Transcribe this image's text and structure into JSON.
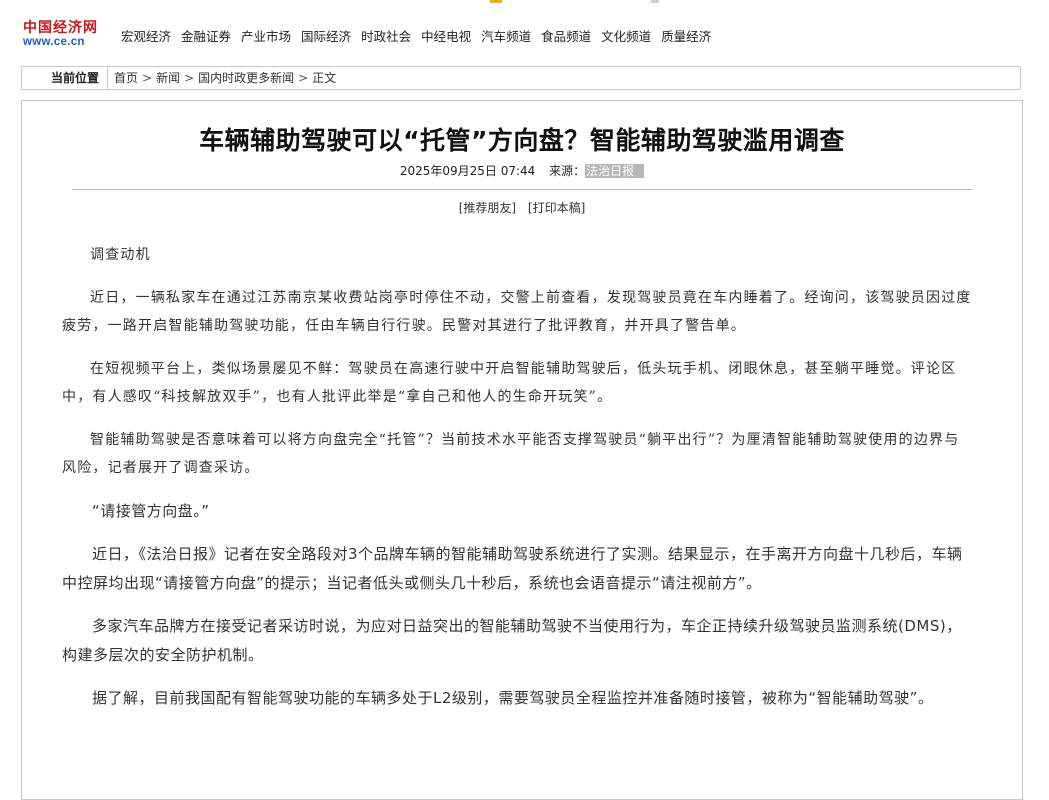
{
  "site": {
    "logo_text": "中国经济网",
    "logo_url": "www.ce.cn"
  },
  "nav": [
    "宏观经济",
    "金融证券",
    "产业市场",
    "国际经济",
    "时政社会",
    "中经电视",
    "汽车频道",
    "食品频道",
    "文化频道",
    "质量经济"
  ],
  "breadcrumb": {
    "label": "当前位置",
    "items": [
      "首页",
      "新闻",
      "国内时政更多新闻",
      "正文"
    ],
    "separator": ">"
  },
  "article": {
    "title": "车辆辅助驾驶可以“托管”方向盘？智能辅助驾驶滥用调查",
    "datetime": "2025年09月25日 07:44",
    "source_label": "来源：",
    "source": "法治日报",
    "tools": [
      "[推荐朋友]",
      "[打印本稿]"
    ],
    "paragraphs": [
      "调查动机",
      "近日，一辆私家车在通过江苏南京某收费站岗亭时停住不动，交警上前查看，发现驾驶员竟在车内睡着了。经询问，该驾驶员因过度疲劳，一路开启智能辅助驾驶功能，任由车辆自行行驶。民警对其进行了批评教育，并开具了警告单。",
      "在短视频平台上，类似场景屡见不鲜：驾驶员在高速行驶中开启智能辅助驾驶后，低头玩手机、闭眼休息，甚至躺平睡觉。评论区中，有人感叹“科技解放双手”，也有人批评此举是“拿自己和他人的生命开玩笑”。",
      "智能辅助驾驶是否意味着可以将方向盘完全“托管”？当前技术水平能否支撑驾驶员“躺平出行”？为厘清智能辅助驾驶使用的边界与风险，记者展开了调查采访。",
      "“请接管方向盘。”",
      "近日，《法治日报》记者在安全路段对3个品牌车辆的智能辅助驾驶系统进行了实测。结果显示，在手离开方向盘十几秒后，车辆中控屏均出现“请接管方向盘”的提示；当记者低头或侧头几十秒后，系统也会语音提示“请注视前方”。",
      "多家汽车品牌方在接受记者采访时说，为应对日益突出的智能辅助驾驶不当使用行为，车企正持续升级驾驶员监测系统(DMS)，构建多层次的安全防护机制。",
      "据了解，目前我国配有智能驾驶功能的车辆多处于L2级别，需要驾驶员全程监控并准备随时接管，被称为“智能辅助驾驶”。"
    ]
  }
}
